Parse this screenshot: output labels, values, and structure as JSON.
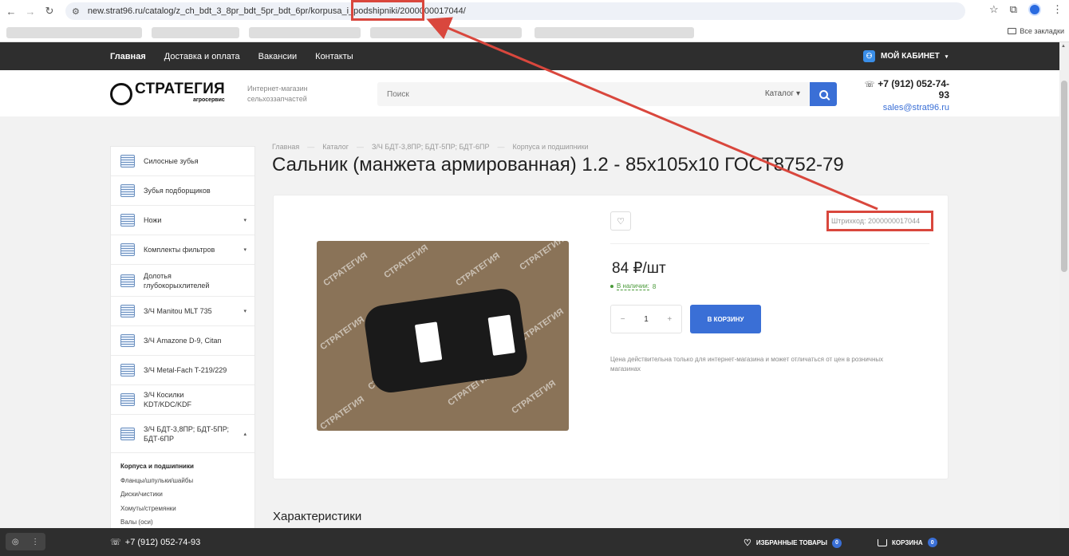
{
  "browser": {
    "url_prefix": "new.strat96.ru/catalog/z_ch_bdt_3_8pr_bdt_5pr_bdt_6pr/korpusa_i_podshipniki/",
    "url_highlight": "2000000017044/",
    "all_bookmarks": "Все закладки"
  },
  "topnav": {
    "items": [
      "Главная",
      "Доставка и оплата",
      "Вакансии",
      "Контакты"
    ],
    "cabinet": "МОЙ КАБИНЕТ"
  },
  "header": {
    "logo_name": "СТРАТЕГИЯ",
    "logo_sub": "агросервис",
    "tagline": "Интернет-магазин сельхоззапчастей",
    "search_placeholder": "Поиск",
    "search_catalog": "Каталог",
    "phone": "+7 (912) 052-74-93",
    "email": "sales@strat96.ru"
  },
  "sidebar": {
    "items": [
      {
        "label": "Силосные зубья"
      },
      {
        "label": "Зубья подборщиков"
      },
      {
        "label": "Ножи"
      },
      {
        "label": "Комплекты фильтров"
      },
      {
        "label": "Долотья глубокорыхлителей"
      },
      {
        "label": "З/Ч Manitou MLT 735"
      },
      {
        "label": "З/Ч Amazone D-9, Citan"
      },
      {
        "label": "З/Ч Metal-Fach T-219/229"
      },
      {
        "label": "З/Ч Косилки KDT/KDC/KDF"
      },
      {
        "label": "З/Ч БДТ-3,8ПР; БДТ-5ПР; БДТ-6ПР"
      }
    ],
    "subitems": [
      "Корпуса и подшипники",
      "Фланцы/шпульки/шайбы",
      "Диски/чистики",
      "Хомуты/стремянки",
      "Валы (оси)"
    ]
  },
  "breadcrumbs": [
    "Главная",
    "Каталог",
    "З/Ч БДТ-3,8ПР; БДТ-5ПР; БДТ-6ПР",
    "Корпуса и подшипники"
  ],
  "product": {
    "title": "Сальник (манжета армированная) 1.2 - 85х105х10 ГОСТ8752-79",
    "barcode": "Штрихкод: 2000000017044",
    "price": "84 ₽/шт",
    "stock_label": "В наличии:",
    "stock_count": "8",
    "qty": "1",
    "qty_minus": "−",
    "qty_plus": "+",
    "cart_button": "В КОРЗИНУ",
    "note": "Цена действительна только для интернет-магазина и может отличаться от цен в розничных магазинах",
    "watermark": "СТРАТЕГИЯ"
  },
  "specs_title": "Характеристики",
  "bottombar": {
    "phone": "+7 (912) 052-74-93",
    "favorites": "ИЗБРАННЫЕ ТОВАРЫ",
    "favorites_count": "0",
    "cart": "КОРЗИНА",
    "cart_count": "0"
  },
  "colors": {
    "accent": "#3a6fd6",
    "annotation": "#d9473d",
    "nav_bg": "#2e2e2e"
  }
}
